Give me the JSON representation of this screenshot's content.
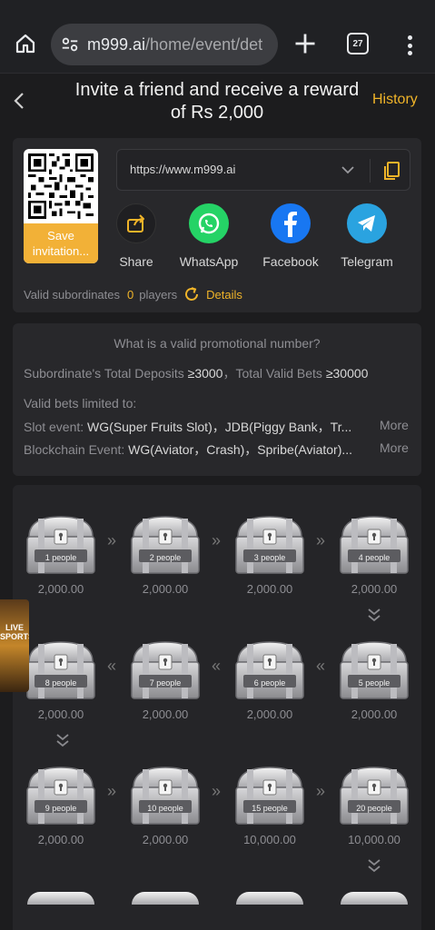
{
  "browser": {
    "url_host": "m999.ai",
    "url_path": "/home/event/det",
    "tab_count": "27"
  },
  "header": {
    "title": "Invite a friend and receive a reward of Rs 2,000",
    "history": "History"
  },
  "share": {
    "save_label": "Save invitation...",
    "link": "https://www.m999.ai",
    "options": [
      "Share",
      "WhatsApp",
      "Facebook",
      "Telegram"
    ],
    "valid_label": "Valid subordinates",
    "valid_count": "0",
    "valid_unit": "players",
    "details": "Details"
  },
  "rules": {
    "question": "What is a valid promotional number?",
    "req_prefix": "Subordinate's Total Deposits ",
    "req_deposit": "≥3000",
    "req_mid": "，Total Valid Bets ",
    "req_bets": "≥30000",
    "limited": "Valid bets limited to:",
    "slot_prefix": "Slot event: ",
    "slot_games": "WG(Super Fruits Slot)，JDB(Piggy Bank，Tr...",
    "block_prefix": "Blockchain Event: ",
    "block_games": "WG(Aviator，Crash)，Spribe(Aviator)...",
    "more": "More"
  },
  "chests": [
    {
      "label": "1 people",
      "amount": "2,000.00"
    },
    {
      "label": "2 people",
      "amount": "2,000.00"
    },
    {
      "label": "3 people",
      "amount": "2,000.00"
    },
    {
      "label": "4 people",
      "amount": "2,000.00"
    },
    {
      "label": "5 people",
      "amount": "2,000.00"
    },
    {
      "label": "6 people",
      "amount": "2,000.00"
    },
    {
      "label": "7 people",
      "amount": "2,000.00"
    },
    {
      "label": "8 people",
      "amount": "2,000.00"
    },
    {
      "label": "9 people",
      "amount": "2,000.00"
    },
    {
      "label": "10 people",
      "amount": "2,000.00"
    },
    {
      "label": "15 people",
      "amount": "10,000.00"
    },
    {
      "label": "20 people",
      "amount": "10,000.00"
    }
  ],
  "badge": {
    "line1": "LIVE",
    "line2": "SPORTS"
  },
  "colors": {
    "accent": "#f0b429",
    "background": "#1c1c1e",
    "card": "#28282b"
  }
}
